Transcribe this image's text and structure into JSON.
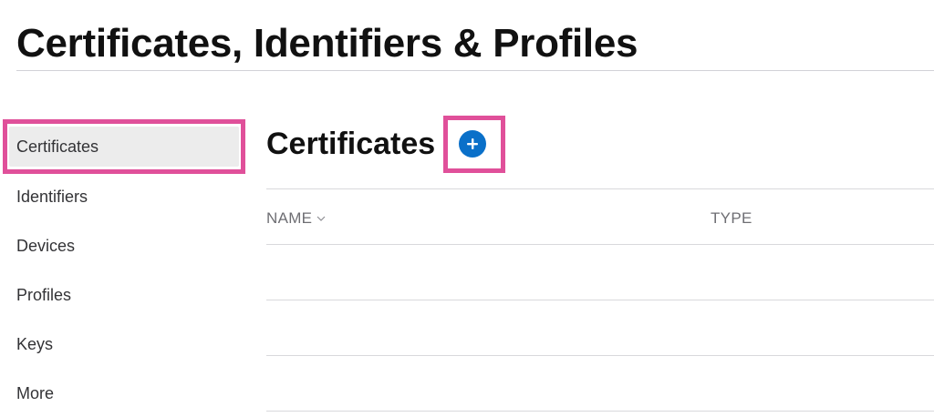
{
  "header": {
    "title": "Certificates, Identifiers & Profiles"
  },
  "sidebar": {
    "items": [
      {
        "label": "Certificates",
        "selected": true
      },
      {
        "label": "Identifiers",
        "selected": false
      },
      {
        "label": "Devices",
        "selected": false
      },
      {
        "label": "Profiles",
        "selected": false
      },
      {
        "label": "Keys",
        "selected": false
      },
      {
        "label": "More",
        "selected": false
      }
    ]
  },
  "main": {
    "section_title": "Certificates",
    "add_button_icon": "plus-circle-icon",
    "table": {
      "columns": [
        {
          "label": "NAME",
          "sort_icon": "chevron-down-icon"
        },
        {
          "label": "TYPE"
        }
      ],
      "rows": []
    }
  },
  "colors": {
    "accent": "#0a70c9",
    "highlight": "#e0509a",
    "selected_bg": "#ececec"
  }
}
